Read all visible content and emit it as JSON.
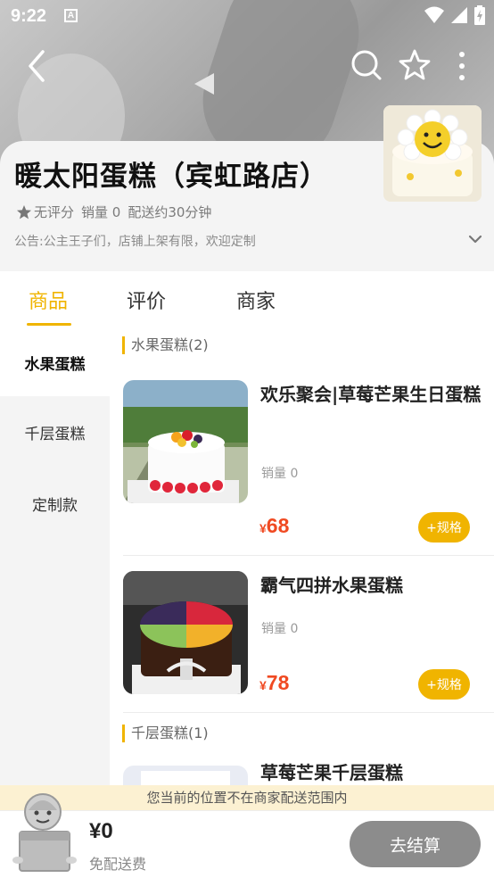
{
  "status_bar": {
    "time": "9:22",
    "notification_icon": "A"
  },
  "nav": {
    "back_icon": "chevron-left",
    "search_icon": "search",
    "favorite_icon": "star-outline",
    "more_icon": "more-vertical"
  },
  "shop": {
    "name": "暖太阳蛋糕（宾虹路店）",
    "rating": "无评分",
    "sales": "销量 0",
    "delivery": "配送约30分钟",
    "notice": "公告:公主王子们，店铺上架有限，欢迎定制"
  },
  "tabs": [
    {
      "label": "商品",
      "active": true
    },
    {
      "label": "评价",
      "active": false
    },
    {
      "label": "商家",
      "active": false
    }
  ],
  "categories": [
    {
      "label": "水果蛋糕",
      "active": true
    },
    {
      "label": "千层蛋糕",
      "active": false
    },
    {
      "label": "定制款",
      "active": false
    }
  ],
  "sections": [
    {
      "title": "水果蛋糕(2)",
      "products": [
        {
          "name": "欢乐聚会|草莓芒果生日蛋糕",
          "sales": "销量 0",
          "currency": "¥",
          "price": "68",
          "spec_label": "+规格"
        },
        {
          "name": "霸气四拼水果蛋糕",
          "sales": "销量 0",
          "currency": "¥",
          "price": "78",
          "spec_label": "+规格"
        }
      ]
    },
    {
      "title": "千层蛋糕(1)",
      "products": [
        {
          "name": "草莓芒果千层蛋糕"
        }
      ]
    }
  ],
  "delivery_tip": "您当前的位置不在商家配送范围内",
  "cart": {
    "total": "¥0",
    "fee": "免配送费",
    "checkout_label": "去结算"
  },
  "colors": {
    "accent": "#f0b400",
    "price": "#f04a22",
    "checkout_disabled": "#8c8c8c",
    "tip_bg": "#fcf1d2"
  }
}
